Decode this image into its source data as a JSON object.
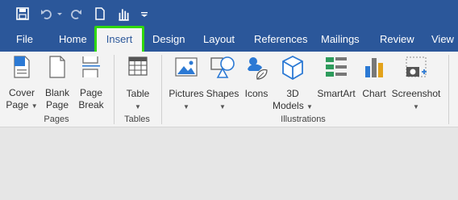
{
  "colors": {
    "accent": "#2b579a",
    "highlight": "#2fd80c",
    "ribbon_bg": "#f3f3f3",
    "canvas_bg": "#e6e6e6"
  },
  "qat": {
    "icons": [
      "save-icon",
      "undo-icon",
      "redo-icon",
      "new-document-icon",
      "touch-mode-icon",
      "customize-qat-icon"
    ]
  },
  "tabs": [
    "File",
    "Home",
    "Insert",
    "Design",
    "Layout",
    "References",
    "Mailings",
    "Review",
    "View"
  ],
  "active_tab": "Insert",
  "ribbon": {
    "pages": {
      "group": "Pages",
      "cover": [
        "Cover",
        "Page"
      ],
      "blank": [
        "Blank",
        "Page"
      ],
      "break": [
        "Page",
        "Break"
      ]
    },
    "tables": {
      "group": "Tables",
      "table": "Table"
    },
    "illustrations": {
      "group": "Illustrations",
      "pictures": "Pictures",
      "shapes": "Shapes",
      "icons": "Icons",
      "models": [
        "3D",
        "Models"
      ],
      "smartart": "SmartArt",
      "chart": "Chart",
      "screenshot": "Screenshot"
    }
  }
}
